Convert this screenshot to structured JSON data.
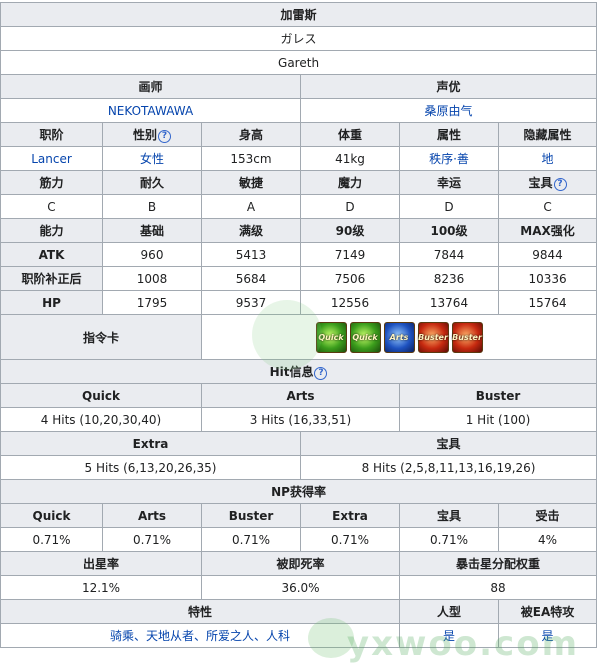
{
  "header": {
    "name_cn": "加雷斯",
    "name_jp": "ガレス",
    "name_en": "Gareth"
  },
  "credits": {
    "labels": [
      "画师",
      "声优"
    ],
    "values": [
      "NEKOTAWAWA",
      "桑原由气"
    ]
  },
  "basic": {
    "labels": [
      "职阶",
      "性别",
      "身高",
      "体重",
      "属性",
      "隐藏属性"
    ],
    "values": [
      "Lancer",
      "女性",
      "153cm",
      "41kg",
      "秩序·善",
      "地"
    ]
  },
  "params": {
    "labels": [
      "筋力",
      "耐久",
      "敏捷",
      "魔力",
      "幸运",
      "宝具"
    ],
    "values": [
      "C",
      "B",
      "A",
      "D",
      "D",
      "C"
    ]
  },
  "stats": {
    "headers": [
      "能力",
      "基础",
      "满级",
      "90级",
      "100级",
      "MAX强化"
    ],
    "rows": [
      [
        "ATK",
        "960",
        "5413",
        "7149",
        "7844",
        "9844"
      ],
      [
        "职阶补正后",
        "1008",
        "5684",
        "7506",
        "8236",
        "10336"
      ],
      [
        "HP",
        "1795",
        "9537",
        "12556",
        "13764",
        "15764"
      ]
    ]
  },
  "command": {
    "label": "指令卡",
    "cards": [
      {
        "type": "q",
        "text": "Quick"
      },
      {
        "type": "q",
        "text": "Quick"
      },
      {
        "type": "a",
        "text": "Arts"
      },
      {
        "type": "b",
        "text": "Buster"
      },
      {
        "type": "b",
        "text": "Buster"
      }
    ]
  },
  "hits": {
    "title": "Hit信息",
    "row1_labels": [
      "Quick",
      "Arts",
      "Buster"
    ],
    "row1_values": [
      "4 Hits (10,20,30,40)",
      "3 Hits (16,33,51)",
      "1 Hit (100)"
    ],
    "row2_labels": [
      "Extra",
      "宝具"
    ],
    "row2_values": [
      "5 Hits (6,13,20,26,35)",
      "8 Hits (2,5,8,11,13,16,19,26)"
    ]
  },
  "np": {
    "title": "NP获得率",
    "labels": [
      "Quick",
      "Arts",
      "Buster",
      "Extra",
      "宝具",
      "受击"
    ],
    "values": [
      "0.71%",
      "0.71%",
      "0.71%",
      "0.71%",
      "0.71%",
      "4%"
    ]
  },
  "star": {
    "labels": [
      "出星率",
      "被即死率",
      "暴击星分配权重"
    ],
    "values": [
      "12.1%",
      "36.0%",
      "88"
    ]
  },
  "traits": {
    "labels": [
      "特性",
      "人型",
      "被EA特攻"
    ],
    "values": [
      "骑乘、天地从者、所爱之人、人科",
      "是",
      "是"
    ]
  },
  "watermark": {
    "text": "yxwoo.com"
  }
}
